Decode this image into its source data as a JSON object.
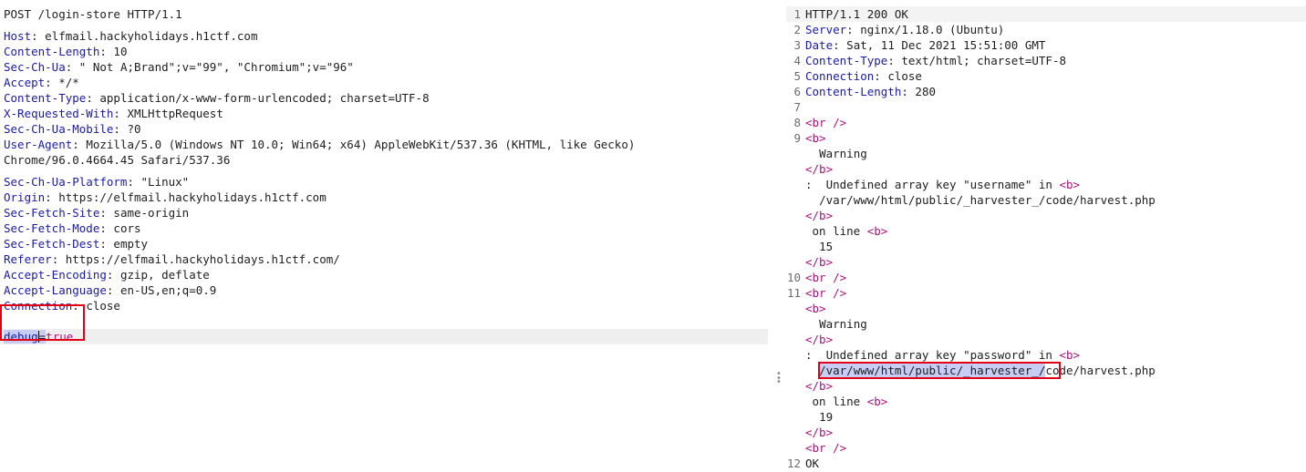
{
  "request": {
    "request_line": "POST /login-store HTTP/1.1",
    "headers": [
      {
        "name": "Host",
        "value": "elfmail.hackyholidays.h1ctf.com"
      },
      {
        "name": "Content-Length",
        "value": "10"
      },
      {
        "name": "Sec-Ch-Ua",
        "value": "\" Not A;Brand\";v=\"99\", \"Chromium\";v=\"96\""
      },
      {
        "name": "Accept",
        "value": "*/*"
      },
      {
        "name": "Content-Type",
        "value": "application/x-www-form-urlencoded; charset=UTF-8"
      },
      {
        "name": "X-Requested-With",
        "value": "XMLHttpRequest"
      },
      {
        "name": "Sec-Ch-Ua-Mobile",
        "value": "?0"
      },
      {
        "name": "User-Agent",
        "value": "Mozilla/5.0 (Windows NT 10.0; Win64; x64) AppleWebKit/537.36 (KHTML, like Gecko)"
      }
    ],
    "user_agent_continuation": "Chrome/96.0.4664.45 Safari/537.36",
    "headers_after": [
      {
        "name": "Sec-Ch-Ua-Platform",
        "value": "\"Linux\""
      },
      {
        "name": "Origin",
        "value": "https://elfmail.hackyholidays.h1ctf.com"
      },
      {
        "name": "Sec-Fetch-Site",
        "value": "same-origin"
      },
      {
        "name": "Sec-Fetch-Mode",
        "value": "cors"
      },
      {
        "name": "Sec-Fetch-Dest",
        "value": "empty"
      },
      {
        "name": "Referer",
        "value": "https://elfmail.hackyholidays.h1ctf.com/"
      },
      {
        "name": "Accept-Encoding",
        "value": "gzip, deflate"
      },
      {
        "name": "Accept-Language",
        "value": "en-US,en;q=0.9"
      },
      {
        "name": "Connection",
        "value": "close"
      }
    ],
    "body": {
      "key": "debug",
      "equals": "=",
      "value": "true"
    }
  },
  "response": {
    "line_numbers": [
      "1",
      "2",
      "3",
      "4",
      "5",
      "6",
      "",
      "8",
      "9",
      "",
      "",
      "",
      "",
      "",
      "",
      "",
      "",
      "",
      "",
      "10",
      "11",
      "",
      "",
      "",
      "",
      "",
      "",
      "",
      "",
      "",
      "",
      "12"
    ],
    "status_line": "HTTP/1.1 200 OK",
    "headers": [
      {
        "name": "Server",
        "value": "nginx/1.18.0 (Ubuntu)"
      },
      {
        "name": "Date",
        "value": "Sat, 11 Dec 2021 15:51:00 GMT"
      },
      {
        "name": "Content-Type",
        "value": "text/html; charset=UTF-8"
      },
      {
        "name": "Connection",
        "value": "close"
      },
      {
        "name": "Content-Length",
        "value": "280"
      }
    ],
    "body": {
      "br_tag": "<br />",
      "b_open": "<b>",
      "b_close": "</b>",
      "warning": "Warning",
      "colon_prefix": ":  ",
      "err1_text": "Undefined array key \"username\" in ",
      "err2_text": "Undefined array key \"password\" in ",
      "path1": "/var/www/html/public/_harvester_/code/harvest.php",
      "path2_selected": "/var/www/html/public/_harvester_/",
      "path2_rest": "code/harvest.php",
      "on_line": "on line ",
      "line1": "15",
      "line2": "19",
      "final": "OK"
    }
  }
}
